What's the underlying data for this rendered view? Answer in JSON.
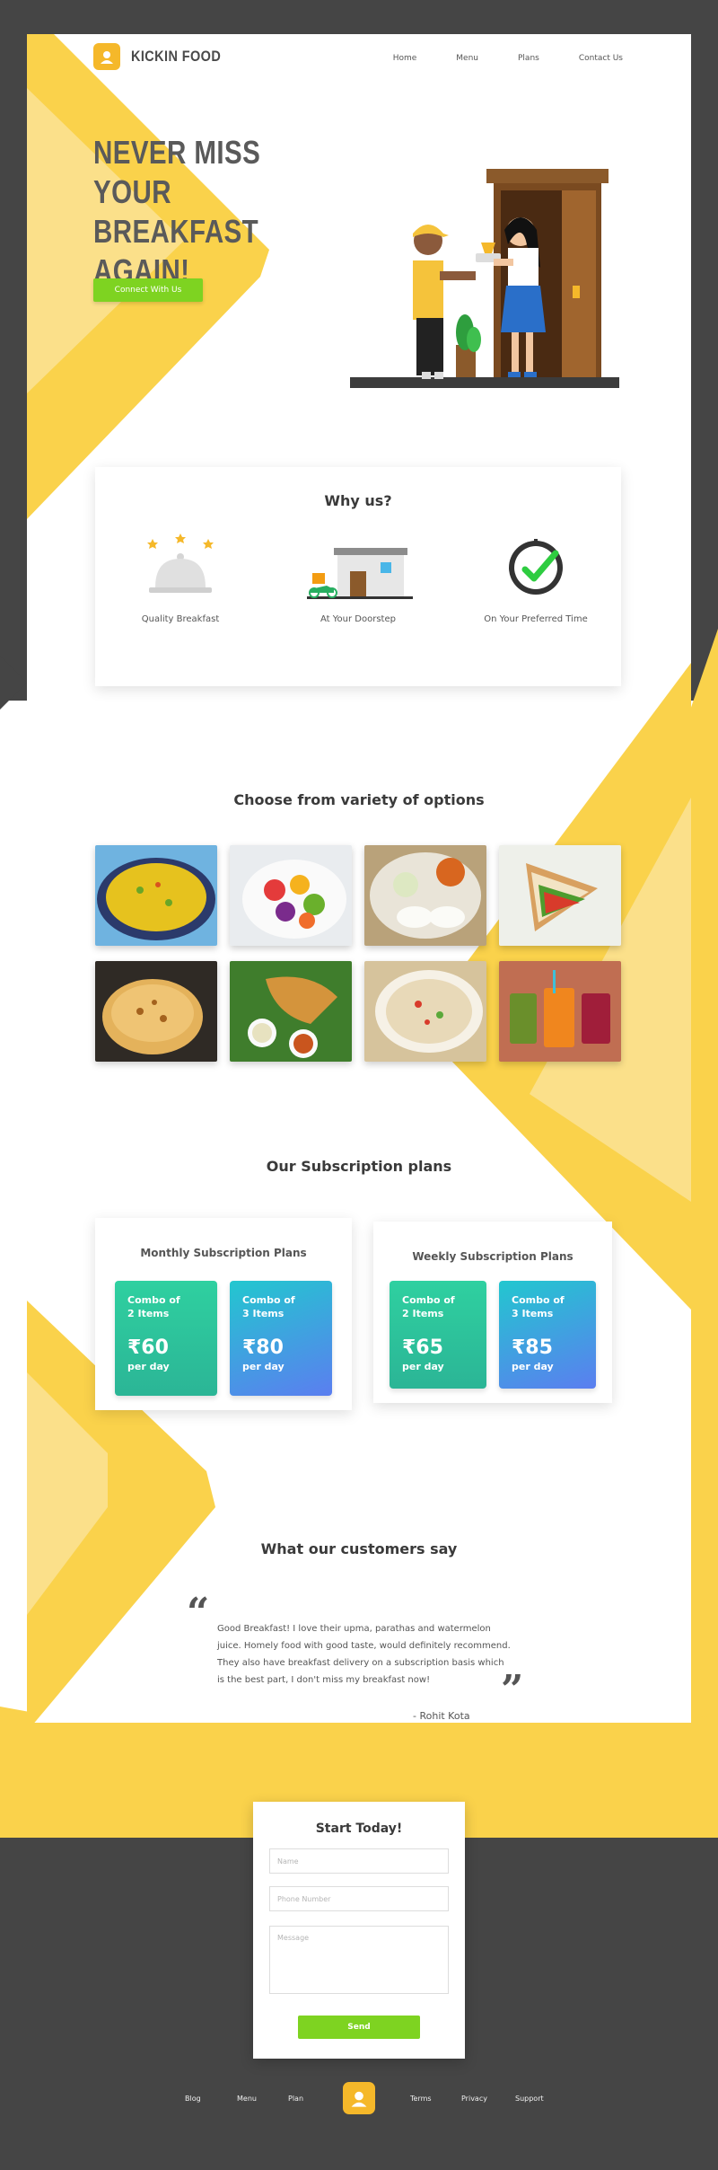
{
  "brand": {
    "name": "KICKIN FOOD",
    "accent": "#f5b82a",
    "cta": "#7ed321"
  },
  "nav": [
    {
      "label": "Home"
    },
    {
      "label": "Menu"
    },
    {
      "label": "Plans"
    },
    {
      "label": "Contact Us"
    }
  ],
  "hero": {
    "title_line1": "NEVER MISS YOUR",
    "title_line2": "BREAKFAST",
    "title_line3": "AGAIN!",
    "cta_label": "Connect With Us"
  },
  "why": {
    "title": "Why us?",
    "items": [
      {
        "label": "Quality Breakfast",
        "icon": "cloche-icon"
      },
      {
        "label": "At Your Doorstep",
        "icon": "delivery-icon"
      },
      {
        "label": "On Your Preferred Time",
        "icon": "clock-icon"
      }
    ]
  },
  "options": {
    "title": "Choose from variety of options",
    "dishes": [
      "upma",
      "fruit salad",
      "idli sambar",
      "sandwich",
      "paratha",
      "dosa",
      "poha",
      "juices"
    ]
  },
  "plans": {
    "title": "Our Subscription plans",
    "monthly": {
      "title": "Monthly Subscription Plans",
      "tiles": [
        {
          "name": "Combo of\n2 Items",
          "price": "₹60",
          "per": "per day"
        },
        {
          "name": "Combo of\n3 Items",
          "price": "₹80",
          "per": "per day"
        }
      ]
    },
    "weekly": {
      "title": "Weekly Subscription Plans",
      "tiles": [
        {
          "name": "Combo of\n2 Items",
          "price": "₹65",
          "per": "per day"
        },
        {
          "name": "Combo of\n3 Items",
          "price": "₹85",
          "per": "per day"
        }
      ]
    }
  },
  "testimonial": {
    "title": "What our customers say",
    "quote": "Good Breakfast! I love their upma, parathas and watermelon juice. Homely food with good taste, would definitely recommend. They also have breakfast delivery on a subscription basis which is the best part, I don't miss my breakfast now!",
    "author": "- Rohit Kota"
  },
  "form": {
    "title": "Start Today!",
    "name_placeholder": "Name",
    "phone_placeholder": "Phone Number",
    "message_placeholder": "Message",
    "send_label": "Send"
  },
  "footer": {
    "links": [
      "Blog",
      "Menu",
      "Plan",
      "Terms",
      "Privacy",
      "Support"
    ]
  }
}
